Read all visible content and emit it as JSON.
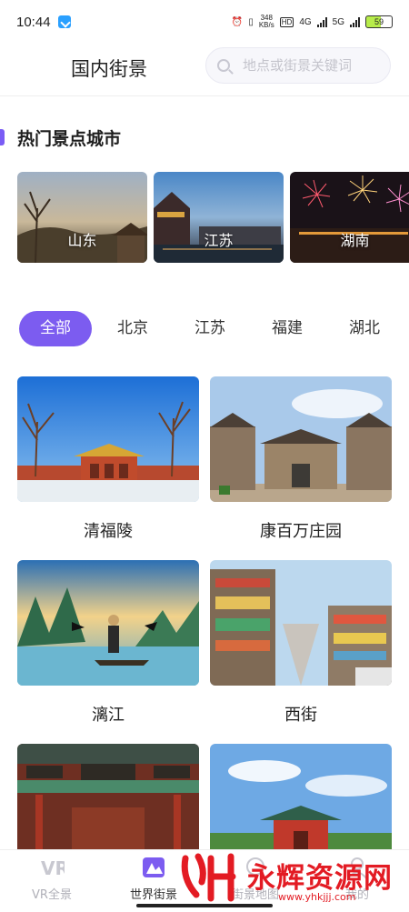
{
  "status_bar": {
    "time": "10:44",
    "speed": "348",
    "speed_unit": "KB/s",
    "hd": "HD",
    "net1": "4G",
    "net2": "5G",
    "battery": "59"
  },
  "header": {
    "title": "国内街景",
    "search_placeholder": "地点或街景关键词"
  },
  "hot_section": {
    "title": "热门景点城市",
    "cities": [
      {
        "label": "山东"
      },
      {
        "label": "江苏"
      },
      {
        "label": "湖南"
      }
    ]
  },
  "filter_tabs": [
    {
      "label": "全部",
      "active": true
    },
    {
      "label": "北京"
    },
    {
      "label": "江苏"
    },
    {
      "label": "福建"
    },
    {
      "label": "湖北"
    }
  ],
  "spots": [
    {
      "name": "清福陵"
    },
    {
      "name": "康百万庄园"
    },
    {
      "name": "漓江"
    },
    {
      "name": "西街"
    },
    {
      "name": ""
    },
    {
      "name": ""
    }
  ],
  "bottom_nav": [
    {
      "label": "VR全景",
      "icon": "vr-icon"
    },
    {
      "label": "世界街景",
      "icon": "world-street-icon",
      "active": true
    },
    {
      "label": "街景地图",
      "icon": "map-icon"
    },
    {
      "label": "我的",
      "icon": "profile-icon"
    }
  ],
  "watermark": {
    "text": "永辉资源网",
    "url": "www.yhkjjj.com"
  },
  "colors": {
    "accent": "#7c5cf0",
    "watermark": "#e31b23"
  }
}
